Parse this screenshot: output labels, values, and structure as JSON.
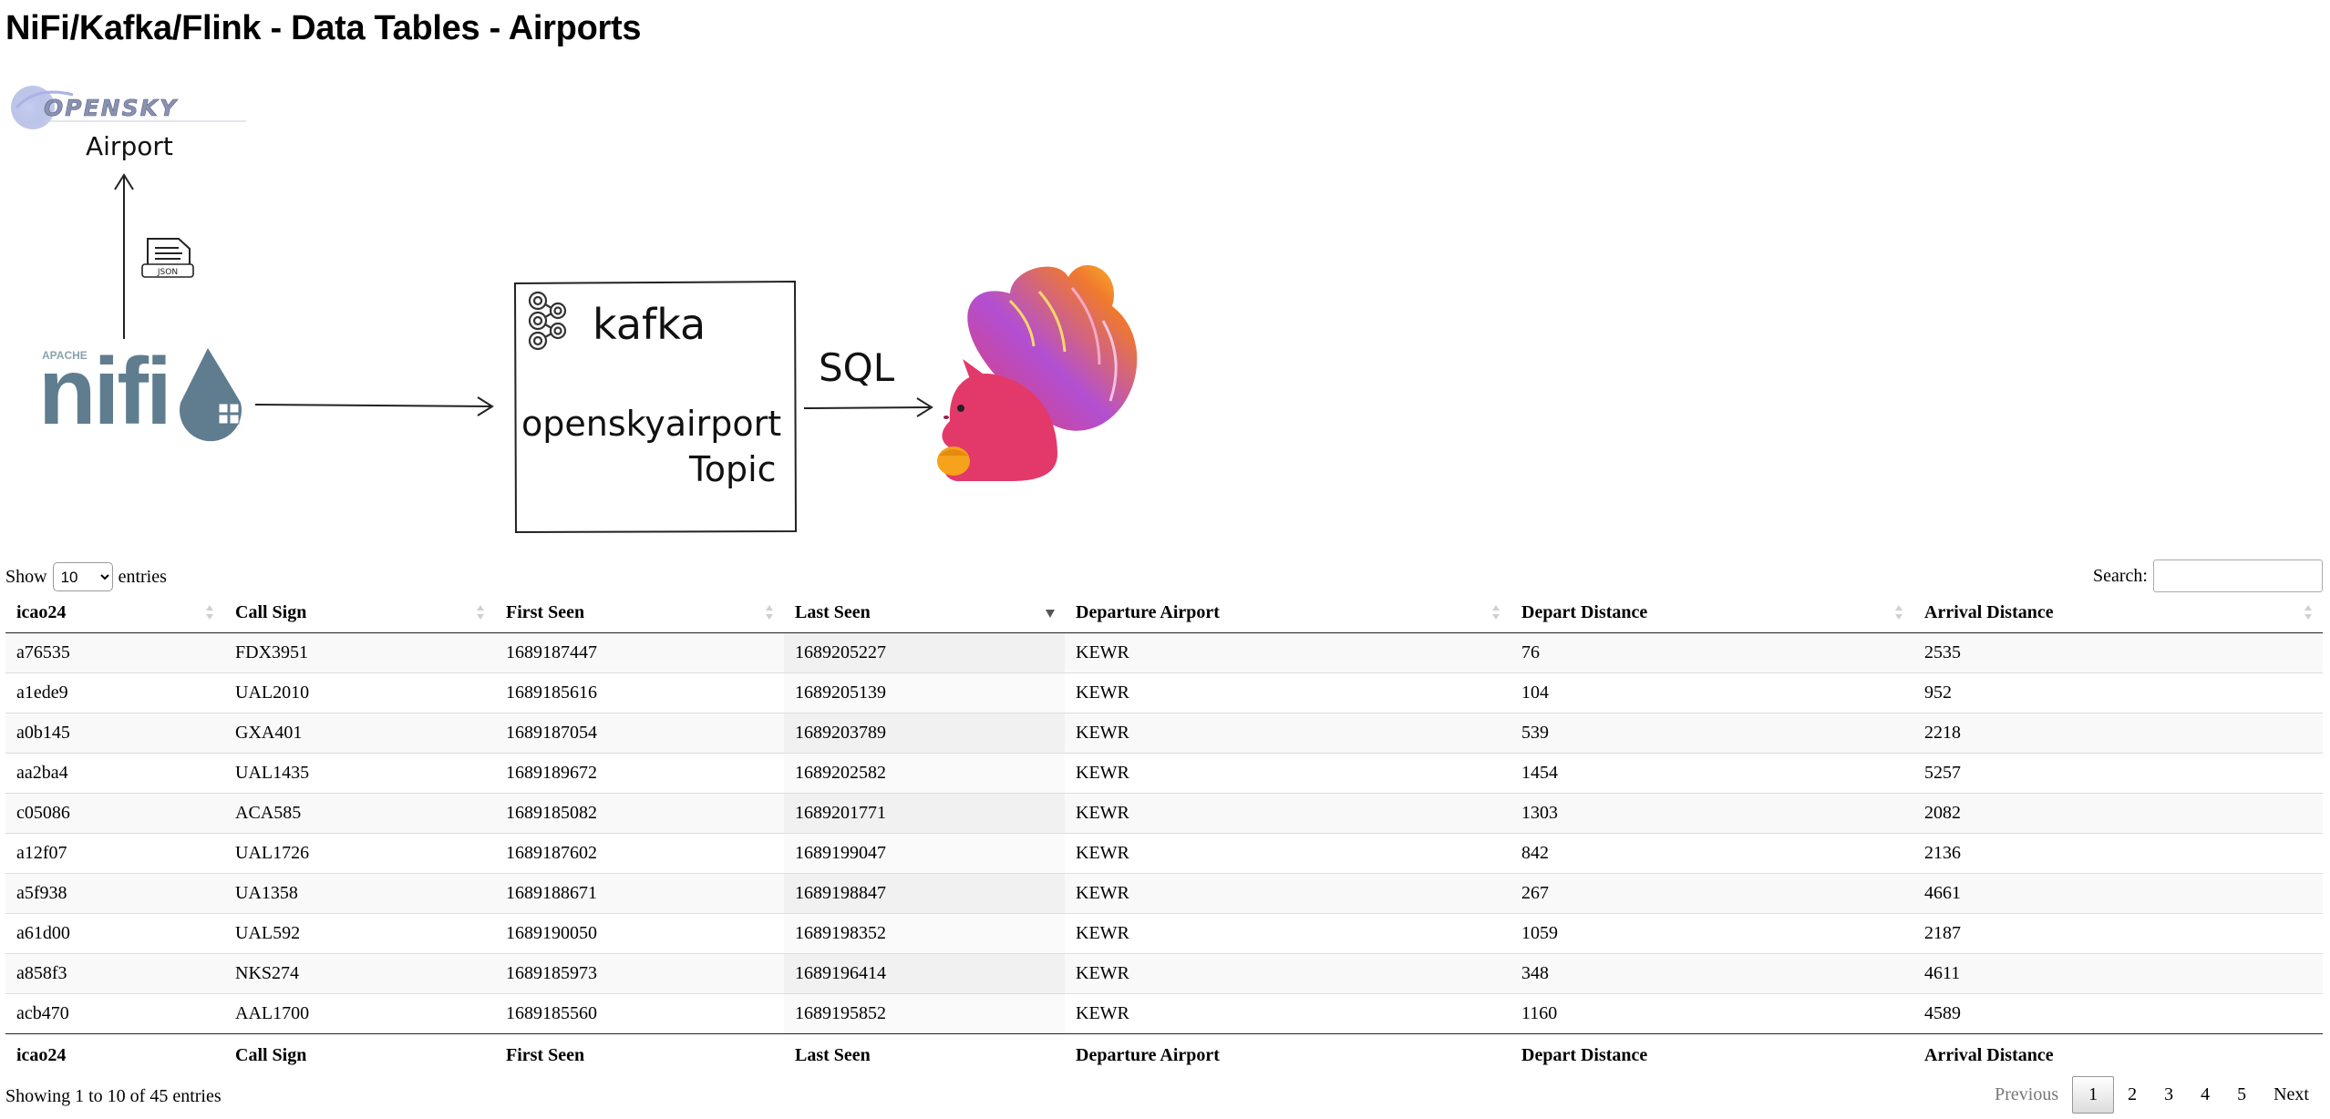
{
  "page": {
    "title": "NiFi/Kafka/Flink - Data Tables - Airports"
  },
  "diagram": {
    "opensky_logo": "OPENSKY",
    "airport_label": "Airport",
    "json_label": "JSON",
    "nifi_apache": "APACHE",
    "nifi_logo": "nifi",
    "kafka_logo": "kafka",
    "topic_line1": "openskyairport",
    "topic_line2": "Topic",
    "sql_label": "SQL",
    "flink_logo": "flink-squirrel-logo",
    "colors": {
      "nifi": "#5f7d8f",
      "flink_body": "#e3396a",
      "flink_tail": "#a259d9",
      "flink_fire": "#f6a21a"
    }
  },
  "controls": {
    "show_label": "Show",
    "length_value": "10",
    "entries_label": "entries",
    "search_label": "Search:",
    "search_value": ""
  },
  "table": {
    "columns": [
      "icao24",
      "Call Sign",
      "First Seen",
      "Last Seen",
      "Departure Airport",
      "Depart Distance",
      "Arrival Distance"
    ],
    "sorted_column": "Last Seen",
    "sort_direction": "descending",
    "rows": [
      [
        "a76535",
        "FDX3951",
        "1689187447",
        "1689205227",
        "KEWR",
        "76",
        "2535"
      ],
      [
        "a1ede9",
        "UAL2010",
        "1689185616",
        "1689205139",
        "KEWR",
        "104",
        "952"
      ],
      [
        "a0b145",
        "GXA401",
        "1689187054",
        "1689203789",
        "KEWR",
        "539",
        "2218"
      ],
      [
        "aa2ba4",
        "UAL1435",
        "1689189672",
        "1689202582",
        "KEWR",
        "1454",
        "5257"
      ],
      [
        "c05086",
        "ACA585",
        "1689185082",
        "1689201771",
        "KEWR",
        "1303",
        "2082"
      ],
      [
        "a12f07",
        "UAL1726",
        "1689187602",
        "1689199047",
        "KEWR",
        "842",
        "2136"
      ],
      [
        "a5f938",
        "UA1358",
        "1689188671",
        "1689198847",
        "KEWR",
        "267",
        "4661"
      ],
      [
        "a61d00",
        "UAL592",
        "1689190050",
        "1689198352",
        "KEWR",
        "1059",
        "2187"
      ],
      [
        "a858f3",
        "NKS274",
        "1689185973",
        "1689196414",
        "KEWR",
        "348",
        "4611"
      ],
      [
        "acb470",
        "AAL1700",
        "1689185560",
        "1689195852",
        "KEWR",
        "1160",
        "4589"
      ]
    ]
  },
  "footer": {
    "info": "Showing 1 to 10 of 45 entries",
    "previous_label": "Previous",
    "pages": [
      "1",
      "2",
      "3",
      "4",
      "5"
    ],
    "current_page": "1",
    "next_label": "Next"
  }
}
